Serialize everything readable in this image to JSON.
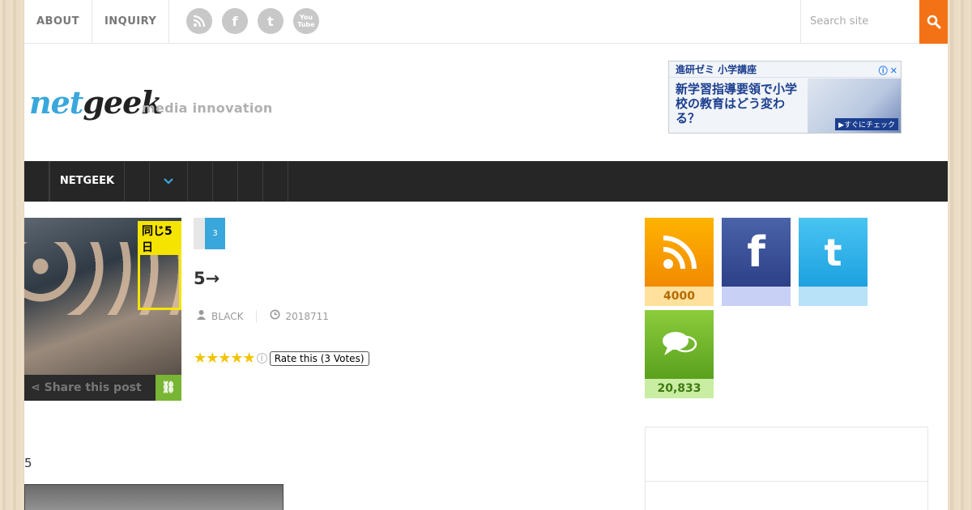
{
  "topnav": {
    "items": [
      {
        "label": "ABOUT"
      },
      {
        "label": "INQUIRY"
      }
    ]
  },
  "social_top": [
    {
      "icon": "rss-icon",
      "glyph": "◥"
    },
    {
      "icon": "facebook-icon",
      "glyph": "f"
    },
    {
      "icon": "twitter-icon",
      "glyph": "t"
    },
    {
      "icon": "youtube-icon",
      "glyph": "You\nTube"
    }
  ],
  "search": {
    "placeholder": "Search site"
  },
  "logo": {
    "part1": "net",
    "part2": "geek",
    "tagline": "media innovation"
  },
  "ad": {
    "header": "進研ゼミ 小学講座",
    "body": "新学習指導要領で小学校の教育はどう変わる？",
    "cta": "▶すぐにチェック"
  },
  "mainnav": {
    "netgeek_label": "NETGEEK",
    "dropdown_glyph": "⌄"
  },
  "post": {
    "thumb_caption": "同じ5日",
    "share_label": "Share this post",
    "category_number": "3",
    "title": "5→",
    "author": "BLACK",
    "date": "2018711",
    "rating_label": "Rate this (3 Votes)",
    "star_count": 5,
    "body_text": "5"
  },
  "sidebar": {
    "rss": {
      "count": "4000"
    },
    "facebook": {
      "count": ""
    },
    "twitter": {
      "count": ""
    },
    "comments": {
      "count": "20,833"
    }
  },
  "colors": {
    "accent": "#39a7db",
    "search_button": "#f47216",
    "nav_bg": "#262626",
    "share_link": "#79b534"
  }
}
